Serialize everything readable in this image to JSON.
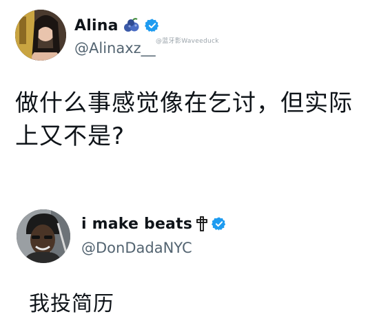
{
  "post_1": {
    "display_name": "Alina",
    "handle": "@Alinaxz__",
    "watermark": "@蓝牙影Waveeduck",
    "text": "做什么事感觉像在乞讨，但实际上又不是?",
    "name_emoji": "blueberries-icon",
    "verified": true
  },
  "post_2": {
    "display_name": "i make beats",
    "handle": "@DonDadaNYC",
    "text": "我投简历",
    "name_emoji": "cross-icon",
    "verified": true
  },
  "colors": {
    "verified_blue": "#1d9bf0",
    "handle_gray": "#536471",
    "text": "#0f1419"
  }
}
